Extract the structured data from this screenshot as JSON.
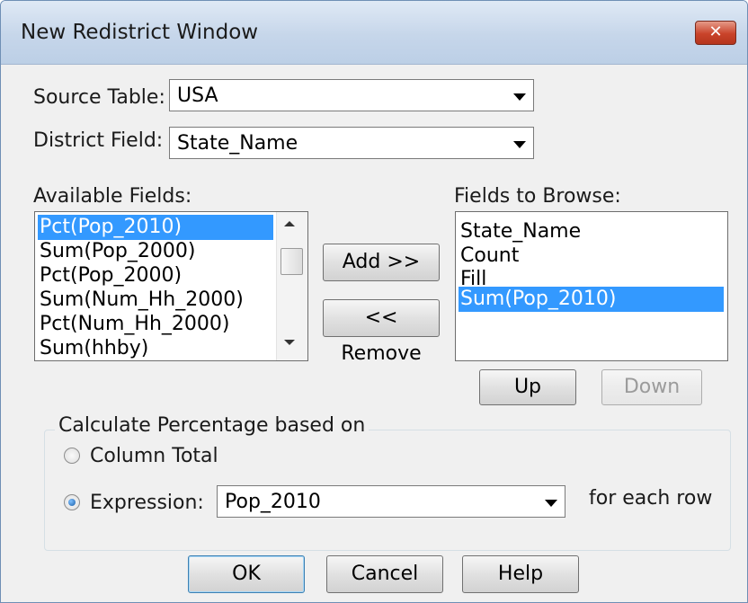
{
  "window": {
    "title": "New Redistrict Window",
    "close_glyph": "✕"
  },
  "source_table": {
    "label": "Source Table:",
    "value": "USA"
  },
  "district_field": {
    "label": "District Field:",
    "value": "State_Name"
  },
  "available_fields": {
    "label": "Available Fields:",
    "items": [
      "Pct(Pop_2010)",
      "Sum(Pop_2000)",
      "Pct(Pop_2000)",
      "Sum(Num_Hh_2000)",
      "Pct(Num_Hh_2000)",
      "Sum(hhby)"
    ],
    "selected_index": 0
  },
  "buttons": {
    "add": "Add >>",
    "remove": "<< Remove",
    "up": "Up",
    "down": "Down",
    "ok": "OK",
    "cancel": "Cancel",
    "help": "Help"
  },
  "fields_to_browse": {
    "label": "Fields to Browse:",
    "items": [
      "State_Name",
      "Count",
      "Fill",
      "Sum(Pop_2010)"
    ],
    "selected_index": 3
  },
  "percentage": {
    "group_label": "Calculate Percentage based on",
    "column_total_label": "Column Total",
    "expression_label": "Expression:",
    "expression_value": "Pop_2010",
    "for_each_row": "for each row",
    "selected": "expression"
  },
  "colors": {
    "selection": "#3399ff",
    "dialog_bg": "#f0f0f0",
    "close_button": "#c9432a"
  }
}
